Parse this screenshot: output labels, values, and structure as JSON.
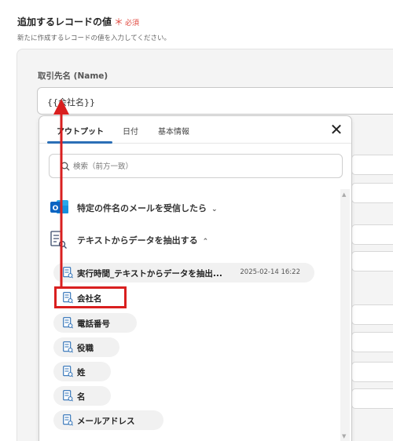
{
  "section": {
    "title": "追加するレコードの値",
    "required_star": "＊",
    "required_text": "必須",
    "description": "新たに作成するレコードの値を入力してください。"
  },
  "field": {
    "label": "取引先名 (Name)",
    "value": "{{会社名}}"
  },
  "popover": {
    "tabs": [
      {
        "label": "アウトプット",
        "active": true
      },
      {
        "label": "日付",
        "active": false
      },
      {
        "label": "基本情報",
        "active": false
      }
    ],
    "close_icon": "✕",
    "search_placeholder": "検索（前方一致）",
    "groups": [
      {
        "label": "特定の件名のメールを受信したら",
        "icon": "outlook-icon",
        "chevron": "⌄"
      },
      {
        "label": "テキストからデータを抽出する",
        "icon": "text-extract-icon",
        "chevron": "⌃"
      }
    ],
    "items": [
      {
        "label": "実行時間_テキストからデータを抽出...",
        "date": "2025-02-14 16:22"
      },
      {
        "label": "会社名",
        "date": ""
      },
      {
        "label": "電話番号",
        "date": ""
      },
      {
        "label": "役職",
        "date": ""
      },
      {
        "label": "姓",
        "date": ""
      },
      {
        "label": "名",
        "date": ""
      },
      {
        "label": "メールアドレス",
        "date": ""
      }
    ]
  },
  "colors": {
    "accent": "#2b6fb6",
    "highlight": "#d91f1f",
    "required": "#e0473d",
    "outlook_blue": "#0a64c2"
  }
}
